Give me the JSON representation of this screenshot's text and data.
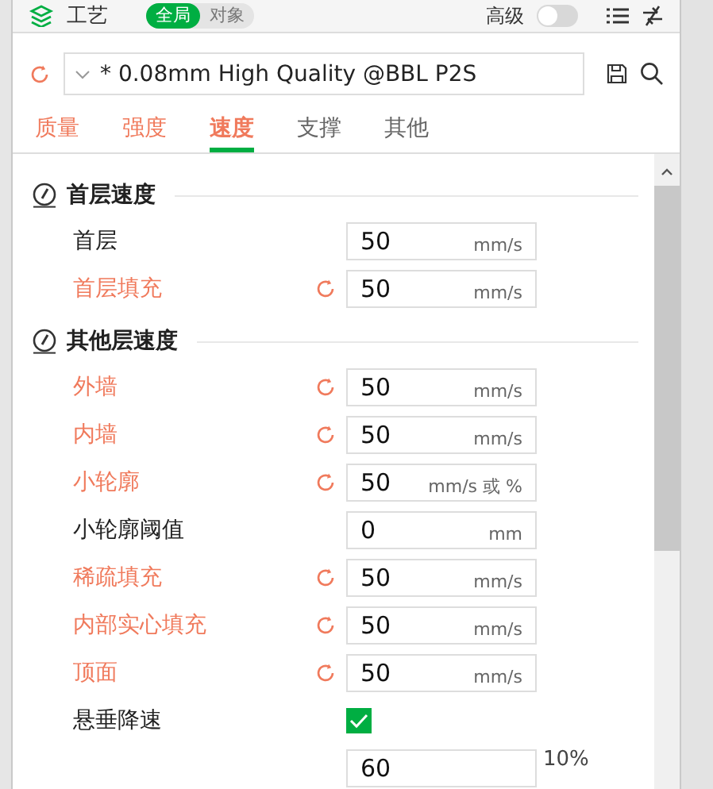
{
  "header": {
    "title": "工艺",
    "scope": [
      {
        "label": "全局",
        "selected": true
      },
      {
        "label": "对象",
        "selected": false
      }
    ],
    "advanced": {
      "label": "高级",
      "on": false
    }
  },
  "preset": {
    "value": "* 0.08mm High Quality @BBL P2S",
    "modified": true
  },
  "tabs": [
    {
      "label": "质量",
      "selected": false,
      "modified": true
    },
    {
      "label": "强度",
      "selected": false,
      "modified": true
    },
    {
      "label": "速度",
      "selected": true,
      "modified": true
    },
    {
      "label": "支撑",
      "selected": false,
      "modified": false
    },
    {
      "label": "其他",
      "selected": false,
      "modified": false
    }
  ],
  "sections": [
    {
      "title": "首层速度",
      "rows": [
        {
          "kind": "field",
          "label": "首层",
          "value": "50",
          "unit": "mm/s",
          "modified": false
        },
        {
          "kind": "field",
          "label": "首层填充",
          "value": "50",
          "unit": "mm/s",
          "modified": true
        }
      ]
    },
    {
      "title": "其他层速度",
      "rows": [
        {
          "kind": "field",
          "label": "外墙",
          "value": "50",
          "unit": "mm/s",
          "modified": true
        },
        {
          "kind": "field",
          "label": "内墙",
          "value": "50",
          "unit": "mm/s",
          "modified": true
        },
        {
          "kind": "field",
          "label": "小轮廓",
          "value": "50",
          "unit": "mm/s 或 %",
          "modified": true
        },
        {
          "kind": "field",
          "label": "小轮廓阈值",
          "value": "0",
          "unit": "mm",
          "modified": false
        },
        {
          "kind": "field",
          "label": "稀疏填充",
          "value": "50",
          "unit": "mm/s",
          "modified": true
        },
        {
          "kind": "field",
          "label": "内部实心填充",
          "value": "50",
          "unit": "mm/s",
          "modified": true
        },
        {
          "kind": "field",
          "label": "顶面",
          "value": "50",
          "unit": "mm/s",
          "modified": true
        },
        {
          "kind": "checkbox",
          "label": "悬垂降速",
          "checked": true
        },
        {
          "kind": "field",
          "value": "60",
          "suffix": "10%",
          "modified": false
        }
      ]
    }
  ]
}
